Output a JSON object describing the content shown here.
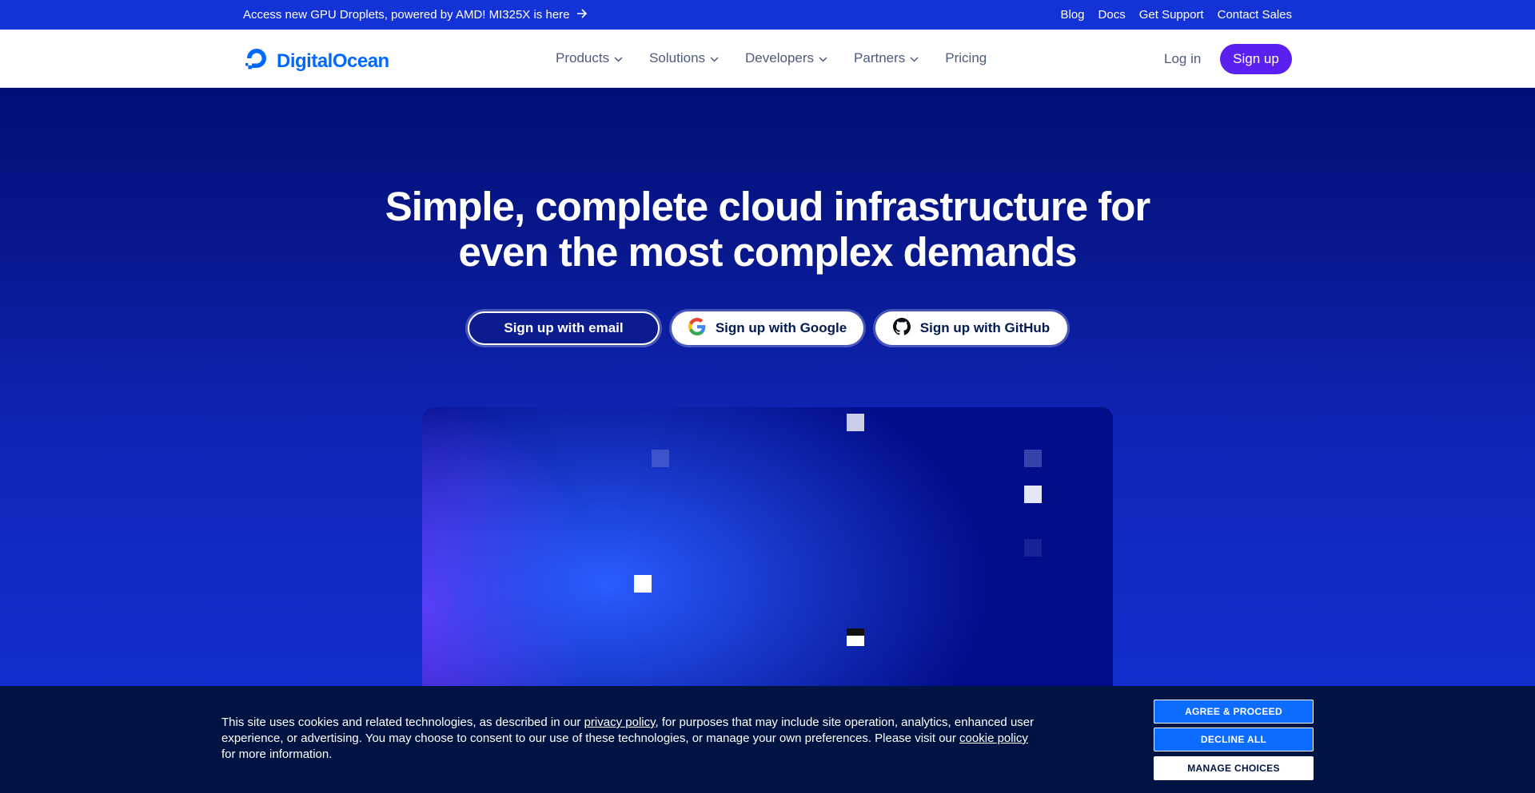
{
  "topbar": {
    "announcement": "Access new GPU Droplets, powered by AMD! MI325X is here",
    "links": [
      "Blog",
      "Docs",
      "Get Support",
      "Contact Sales"
    ]
  },
  "nav": {
    "brand": "DigitalOcean",
    "menu": [
      "Products",
      "Solutions",
      "Developers",
      "Partners",
      "Pricing"
    ],
    "login": "Log in",
    "signup": "Sign up"
  },
  "hero": {
    "title_line1": "Simple, complete cloud infrastructure for",
    "title_line2": "even the most complex demands",
    "cta_email": "Sign up with email",
    "cta_google": "Sign up with Google",
    "cta_github": "Sign up with GitHub"
  },
  "cookie": {
    "text_part1": "This site uses cookies and related technologies, as described in our ",
    "privacy_link": "privacy policy",
    "text_part2": ", for purposes that may include site operation, analytics, enhanced user experience, or advertising. You may choose to consent to our use of these technologies, or manage your own preferences. Please visit our ",
    "cookie_link": "cookie policy",
    "text_part3": " for more information.",
    "agree": "AGREE & PROCEED",
    "decline": "DECLINE ALL",
    "manage": "MANAGE CHOICES"
  },
  "colors": {
    "brand_blue": "#0069ff",
    "signup_purple": "#5b1ff0",
    "topbar": "#1433d6",
    "cookie_bg": "#001443"
  }
}
